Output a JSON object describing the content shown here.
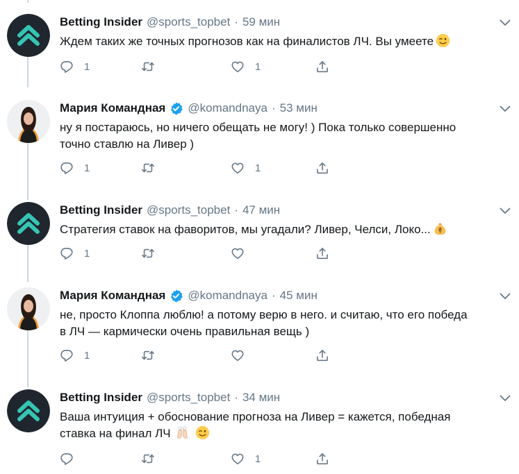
{
  "colors": {
    "brand_avatar_bg": "#1f262e",
    "brand_arrow": "#36c4b4",
    "verified": "#1da1f2",
    "muted": "#657786",
    "thread_line": "#ccd6dd"
  },
  "tweets": [
    {
      "author": "Betting Insider",
      "handle": "@sports_topbet",
      "separator": "·",
      "time": "59 мин",
      "verified": false,
      "text": "Ждем таких же точных прогнозов как на финалистов ЛЧ. Вы умеете",
      "emojis": [
        "winking-face"
      ],
      "replies": "1",
      "retweets": "",
      "likes": "1"
    },
    {
      "author": "Мария Командная",
      "handle": "@komandnaya",
      "separator": "·",
      "time": "53 мин",
      "verified": true,
      "text_line1": "ну я постараюсь, но ничего обещать не могу! ) Пока только совершенно",
      "text_line2": "точно ставлю на Ливер )",
      "replies": "1",
      "retweets": "",
      "likes": "1"
    },
    {
      "author": "Betting Insider",
      "handle": "@sports_topbet",
      "separator": "·",
      "time": "47 мин",
      "verified": false,
      "text": "Стратегия ставок на фаворитов, мы угадали? Ливер, Челси, Локо...",
      "emojis": [
        "money-bag"
      ],
      "replies": "1",
      "retweets": "",
      "likes": ""
    },
    {
      "author": "Мария Командная",
      "handle": "@komandnaya",
      "separator": "·",
      "time": "45 мин",
      "verified": true,
      "text_line1": "не, просто Клоппа люблю! а потому верю в него. и считаю, что его победа",
      "text_line2": "в ЛЧ — кармически очень правильная вещь )",
      "replies": "1",
      "retweets": "",
      "likes": ""
    },
    {
      "author": "Betting Insider",
      "handle": "@sports_topbet",
      "separator": "·",
      "time": "34 мин",
      "verified": false,
      "text_line1": "Ваша интуиция + обоснование прогноза на Ливер = кажется, победная",
      "text_line2": "ставка на финал ЛЧ",
      "emojis": [
        "raising-hands",
        "winking-face"
      ],
      "replies": "",
      "retweets": "",
      "likes": "1"
    }
  ],
  "icons": {
    "reply": "reply-icon",
    "retweet": "retweet-icon",
    "like": "heart-icon",
    "share": "share-icon",
    "more": "chevron-down-icon",
    "verified": "verified-badge-icon"
  }
}
